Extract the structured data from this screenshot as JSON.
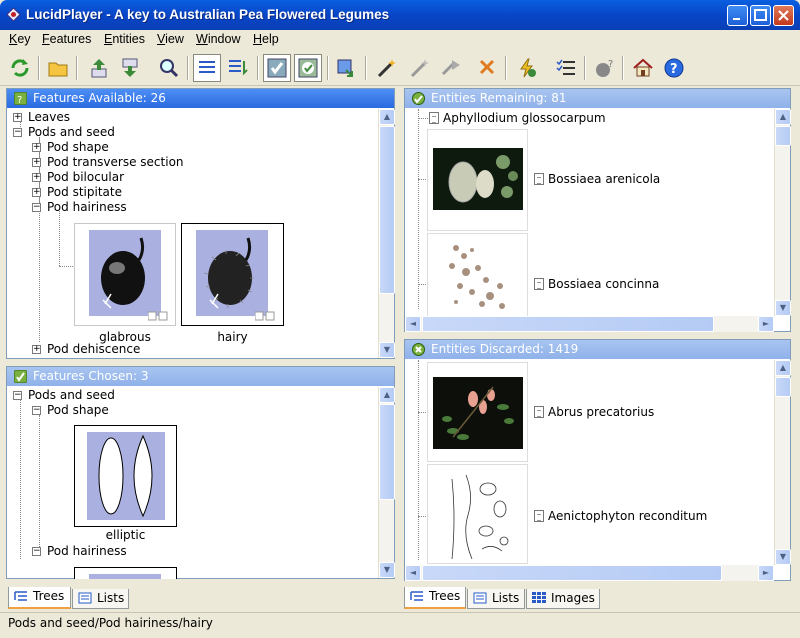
{
  "window": {
    "title": "LucidPlayer - A key to Australian Pea Flowered Legumes"
  },
  "menu": [
    "Key",
    "Features",
    "Entities",
    "View",
    "Window",
    "Help"
  ],
  "features_available": {
    "header": "Features Available: 26",
    "items": [
      "Leaves",
      "Pods and seed",
      "Pod shape",
      "Pod transverse section",
      "Pod bilocular",
      "Pod stipitate",
      "Pod hairiness",
      "Pod dehiscence"
    ],
    "states": [
      "glabrous",
      "hairy"
    ]
  },
  "features_chosen": {
    "header": "Features Chosen: 3",
    "items": [
      "Pods and seed",
      "Pod shape",
      "Pod hairiness"
    ],
    "states": [
      "elliptic"
    ]
  },
  "entities_remaining": {
    "header": "Entities Remaining: 81",
    "items": [
      "Aphyllodium glossocarpum",
      "Bossiaea arenicola",
      "Bossiaea concinna"
    ]
  },
  "entities_discarded": {
    "header": "Entities Discarded: 1419",
    "items": [
      "Abrus precatorius",
      "Aenictophyton reconditum"
    ]
  },
  "left_tabs": [
    "Trees",
    "Lists"
  ],
  "right_tabs": [
    "Trees",
    "Lists",
    "Images"
  ],
  "status": "Pods and seed/Pod hairiness/hairy",
  "colors": {
    "title_blue": "#0846c8",
    "pane_header": "#2a6ae0",
    "pane_header_dim": "#90b2ea",
    "accent_orange": "#f0a040"
  }
}
